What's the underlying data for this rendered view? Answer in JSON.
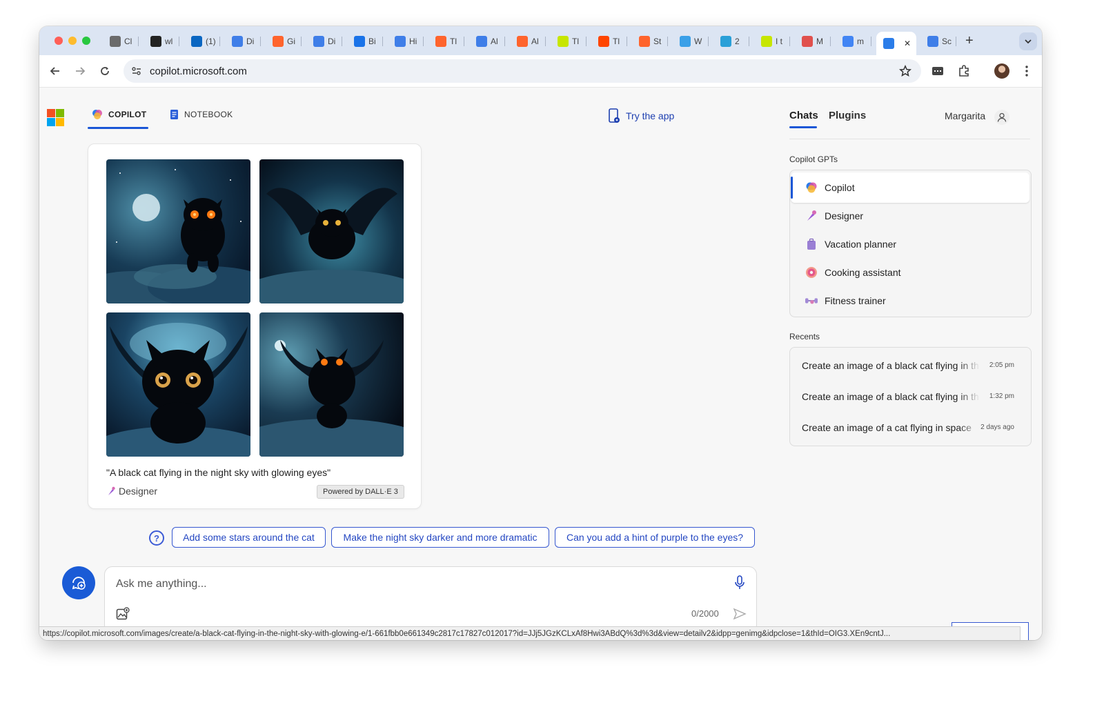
{
  "browser": {
    "tabs": [
      {
        "label": "Cl",
        "icon": "chatgpt-icon",
        "color": "#6b6b6b"
      },
      {
        "label": "wl",
        "icon": "app-icon",
        "color": "#222222"
      },
      {
        "label": "(1)",
        "icon": "linkedin-icon",
        "color": "#0a66c2"
      },
      {
        "label": "Di",
        "icon": "docs-icon",
        "color": "#3f7ee8"
      },
      {
        "label": "Gi",
        "icon": "semrush-icon",
        "color": "#ff642d"
      },
      {
        "label": "Di",
        "icon": "docs-icon",
        "color": "#3f7ee8"
      },
      {
        "label": "Bi",
        "icon": "search-icon",
        "color": "#1a73e8"
      },
      {
        "label": "Hi",
        "icon": "docs-icon",
        "color": "#3f7ee8"
      },
      {
        "label": "Tl",
        "icon": "semrush-icon",
        "color": "#ff642d"
      },
      {
        "label": "Al",
        "icon": "docs-icon",
        "color": "#3f7ee8"
      },
      {
        "label": "Al",
        "icon": "semrush-icon",
        "color": "#ff642d"
      },
      {
        "label": "Tl",
        "icon": "ahrefs-icon",
        "color": "#c7e600"
      },
      {
        "label": "Tl",
        "icon": "orange-square-icon",
        "color": "#ff4500"
      },
      {
        "label": "St",
        "icon": "semrush-icon",
        "color": "#ff642d"
      },
      {
        "label": "W",
        "icon": "m-icon",
        "color": "#3aa0e8"
      },
      {
        "label": "2",
        "icon": "telegram-icon",
        "color": "#2aa0d8"
      },
      {
        "label": "I t",
        "icon": "ahrefs-icon",
        "color": "#c7e600"
      },
      {
        "label": "M",
        "icon": "colorful-icon",
        "color": "#e0504d"
      },
      {
        "label": "m",
        "icon": "google-icon",
        "color": "#4285f4"
      },
      {
        "label": "",
        "icon": "copilot-icon",
        "color": "#2b7de9",
        "active": true
      },
      {
        "label": "Sc",
        "icon": "docs-icon",
        "color": "#3f7ee8"
      }
    ],
    "url": "copilot.microsoft.com",
    "status_url": "https://copilot.microsoft.com/images/create/a-black-cat-flying-in-the-night-sky-with-glowing-e/1-661fbb0e661349c2817c17827c012017?id=JJj5JGzKCLxAf8Hwi3ABdQ%3d%3d&view=detailv2&idpp=genimg&idpclose=1&thId=OIG3.XEn9cntJ..."
  },
  "header": {
    "copilot_tab": "COPILOT",
    "notebook_tab": "NOTEBOOK",
    "try_app": "Try the app"
  },
  "response": {
    "caption": "\"A black cat flying in the night sky with glowing eyes\"",
    "designer_label": "Designer",
    "powered_by": "Powered by DALL·E 3"
  },
  "suggestions": [
    "Add some stars around the cat",
    "Make the night sky darker and more dramatic",
    "Can you add a hint of purple to the eyes?"
  ],
  "composer": {
    "placeholder": "Ask me anything...",
    "counter": "0/2000"
  },
  "sidebar": {
    "tabs": [
      "Chats",
      "Plugins"
    ],
    "user": "Margarita",
    "gpts_label": "Copilot GPTs",
    "gpts": [
      {
        "label": "Copilot",
        "icon": "copilot-icon",
        "selected": true
      },
      {
        "label": "Designer",
        "icon": "designer-icon"
      },
      {
        "label": "Vacation planner",
        "icon": "luggage-icon"
      },
      {
        "label": "Cooking assistant",
        "icon": "donut-icon"
      },
      {
        "label": "Fitness trainer",
        "icon": "dumbbell-icon"
      }
    ],
    "recents_label": "Recents",
    "recents": [
      {
        "title": "Create an image of a black cat flying in the night sky",
        "time": "2:05 pm"
      },
      {
        "title": "Create an image of a black cat flying in the night sky",
        "time": "1:32 pm"
      },
      {
        "title": "Create an image of a cat flying in space",
        "time": "2 days ago"
      }
    ]
  },
  "colors": {
    "accent": "#1a56d6",
    "chip_text": "#2447c2",
    "page_bg": "#f7f7f7",
    "tabstrip_bg": "#dce5f3"
  }
}
